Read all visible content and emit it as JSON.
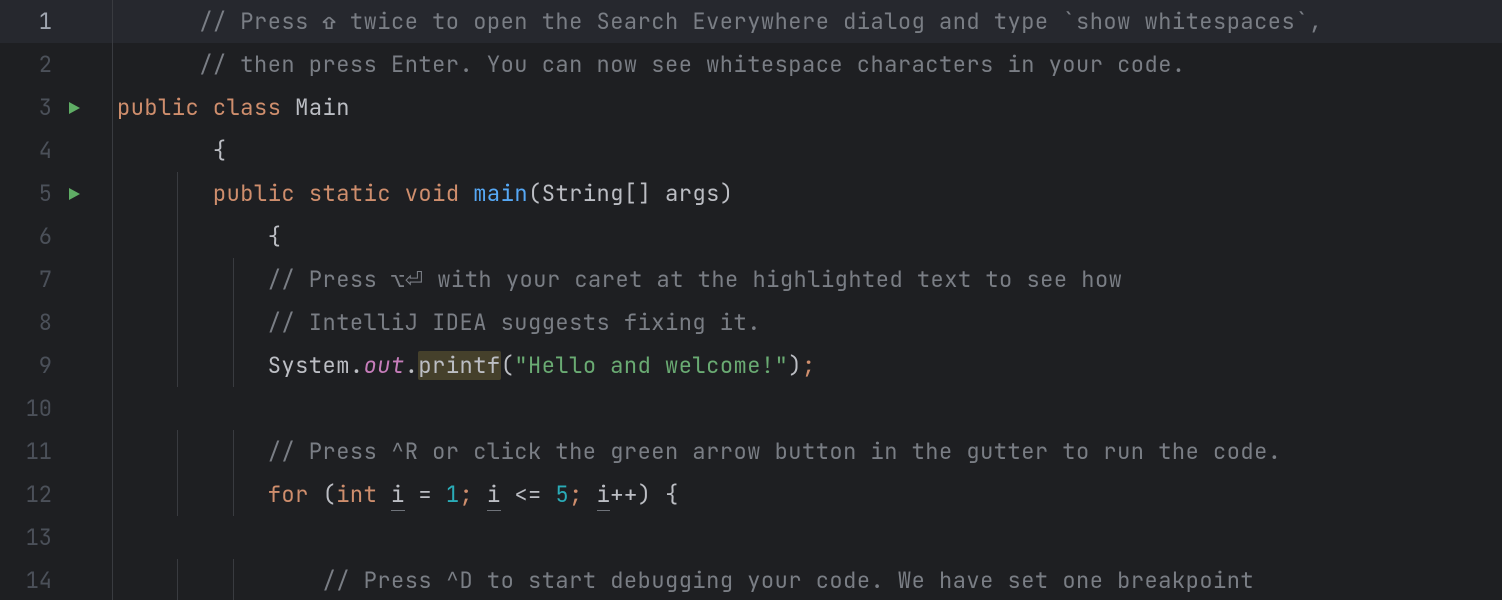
{
  "colors": {
    "background": "#1e1f22",
    "current_line": "#26282e",
    "gutter_text": "#4b5059",
    "comment": "#7a7e85",
    "keyword": "#cf8e6d",
    "method": "#56a8f5",
    "string": "#6aab73",
    "number": "#2aacb8",
    "field": "#c77dbb",
    "default": "#bcbec4",
    "warn_highlight": "#45402b",
    "run_icon": "#5fad65"
  },
  "current_line": 1,
  "run_markers": [
    3,
    5
  ],
  "line_numbers": [
    "1",
    "2",
    "3",
    "4",
    "5",
    "6",
    "7",
    "8",
    "9",
    "10",
    "11",
    "12",
    "13",
    "14"
  ],
  "code": {
    "l1": {
      "comment": "// Press ⇧ twice to open the Search Everywhere dialog and type `show whitespaces`,"
    },
    "l2": {
      "comment": "// then press Enter. You can now see whitespace characters in your code."
    },
    "l3": {
      "kw_public": "public",
      "kw_class": "class",
      "classname": "Main"
    },
    "l4": {
      "brace": "{"
    },
    "l5": {
      "kw_public": "public",
      "kw_static": "static",
      "kw_void": "void",
      "method": "main",
      "params_open": "(",
      "type_string": "String",
      "brackets": "[]",
      "param_name": "args",
      "params_close": ")"
    },
    "l6": {
      "brace": "{"
    },
    "l7": {
      "comment": "// Press ⌥⏎ with your caret at the highlighted text to see how"
    },
    "l8": {
      "comment": "// IntelliJ IDEA suggests fixing it."
    },
    "l9": {
      "class_system": "System",
      "dot1": ".",
      "field_out": "out",
      "dot2": ".",
      "call_printf": "printf",
      "open": "(",
      "string": "\"Hello and welcome!\"",
      "close": ")",
      "semi": ";"
    },
    "l10": {
      "blank": ""
    },
    "l11": {
      "comment": "// Press ^R or click the green arrow button in the gutter to run the code."
    },
    "l12": {
      "kw_for": "for",
      "open": "(",
      "kw_int": "int",
      "var_i1": "i",
      "assign": " = ",
      "num1": "1",
      "semi1": ";",
      "sp1": " ",
      "var_i2": "i",
      "cmp": " <= ",
      "num5": "5",
      "semi2": ";",
      "sp2": " ",
      "var_i3": "i",
      "inc": "++",
      "close": ")",
      "sp3": " ",
      "brace": "{"
    },
    "l13": {
      "blank": ""
    },
    "l14": {
      "comment": "// Press ^D to start debugging your code. We have set one breakpoint"
    }
  }
}
